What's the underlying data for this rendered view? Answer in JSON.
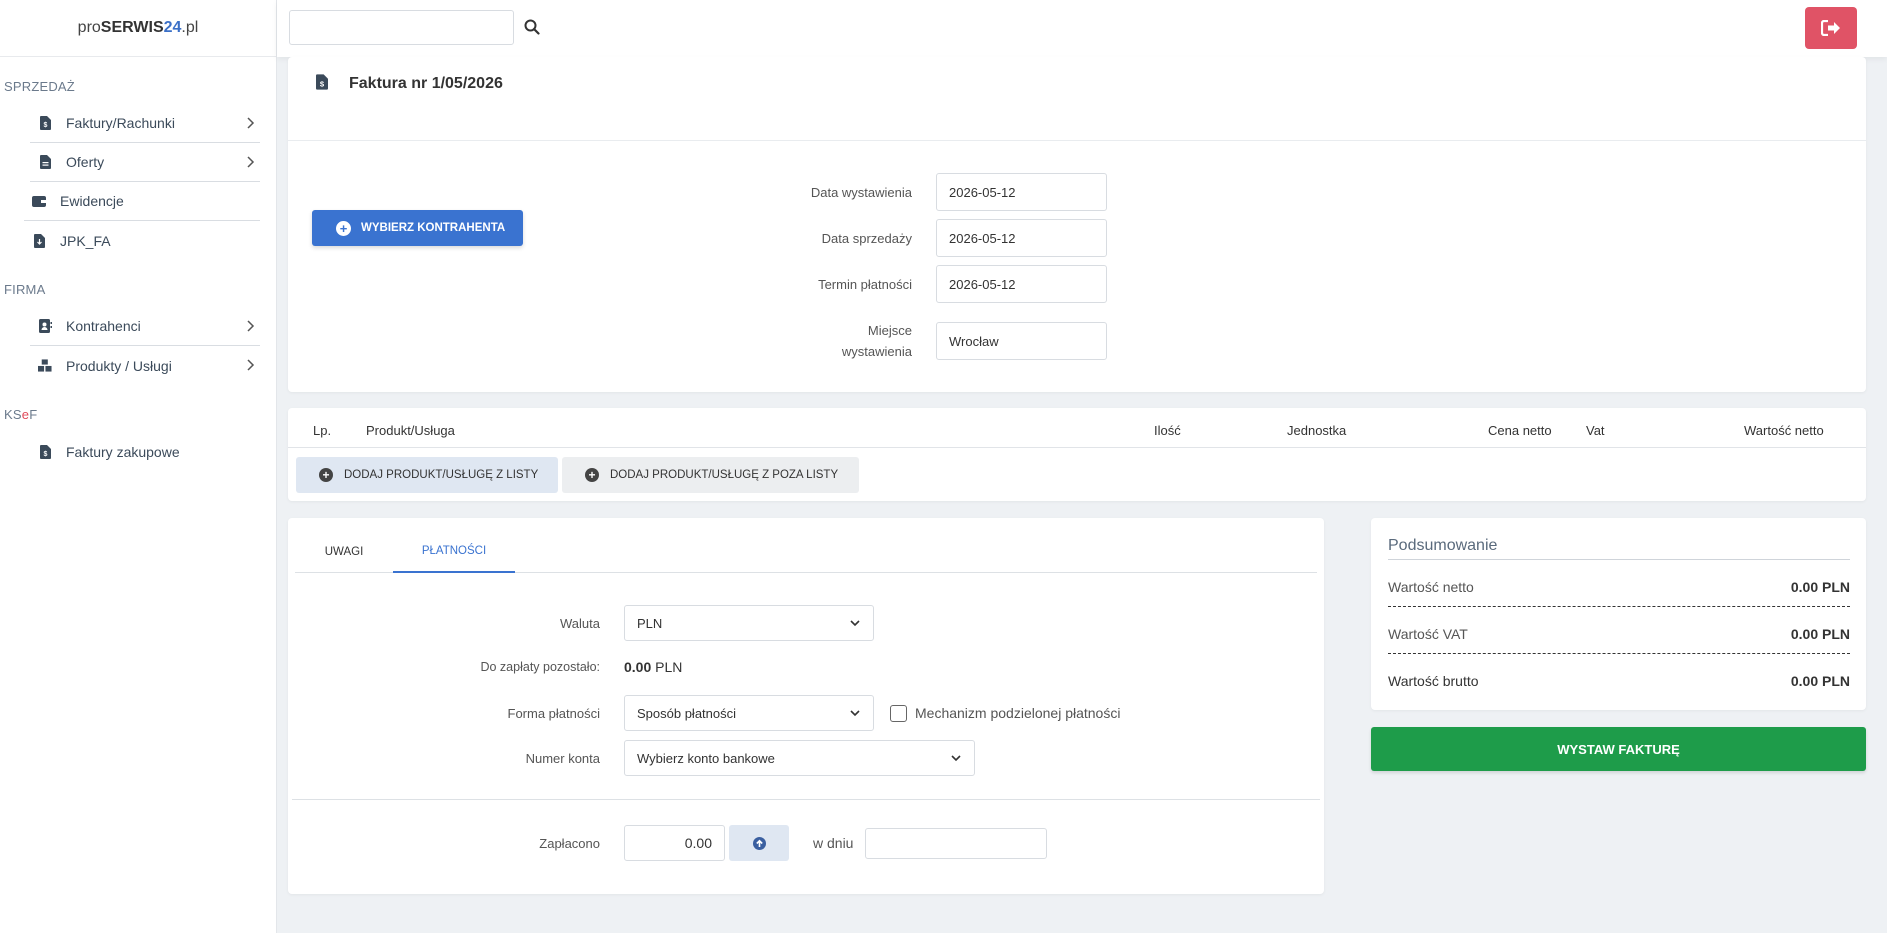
{
  "brand": {
    "pre": "pro",
    "bold": "SERWIS",
    "num": "24",
    "suffix": ".pl"
  },
  "sidebar": {
    "sections": [
      {
        "title": "SPRZEDAŻ",
        "items": [
          {
            "label": "Faktury/Rachunki",
            "icon": "file-invoice-icon",
            "has_chevron": true
          },
          {
            "label": "Oferty",
            "icon": "file-icon",
            "has_chevron": true
          },
          {
            "label": "Ewidencje",
            "icon": "wallet-icon",
            "has_chevron": false
          },
          {
            "label": "JPK_FA",
            "icon": "file-download-icon",
            "has_chevron": false
          }
        ]
      },
      {
        "title": "FIRMA",
        "items": [
          {
            "label": "Kontrahenci",
            "icon": "address-book-icon",
            "has_chevron": true
          },
          {
            "label": "Produkty / Usługi",
            "icon": "boxes-icon",
            "has_chevron": true
          }
        ]
      },
      {
        "title_k": "KS",
        "title_e": "e",
        "title_f": "F",
        "items": [
          {
            "label": "Faktury zakupowe",
            "icon": "file-invoice-icon",
            "has_chevron": false
          }
        ]
      }
    ]
  },
  "topbar": {
    "search_value": ""
  },
  "invoice": {
    "title": "Faktura nr 1/05/2026",
    "pick_contractor_label": "WYBIERZ KONTRAHENTA",
    "fields": {
      "issue_date_label": "Data wystawienia",
      "issue_date": "2026-05-12",
      "sale_date_label": "Data sprzedaży",
      "sale_date": "2026-05-12",
      "due_date_label": "Termin płatności",
      "due_date": "2026-05-12",
      "place_label_1": "Miejsce",
      "place_label_2": "wystawienia",
      "place": "Wrocław"
    }
  },
  "items_table": {
    "columns": {
      "lp": "Lp.",
      "product": "Produkt/Usługa",
      "qty": "Ilość",
      "unit": "Jednostka",
      "net_price": "Cena netto",
      "vat": "Vat",
      "net_value": "Wartość netto"
    },
    "add_from_list": "DODAJ PRODUKT/USŁUGĘ Z LISTY",
    "add_outside_list": "DODAJ PRODUKT/USŁUGĘ Z POZA LISTY"
  },
  "payments": {
    "tabs": {
      "notes": "UWAGI",
      "payments": "PŁATNOŚCI"
    },
    "currency_label": "Waluta",
    "currency": "PLN",
    "remaining_label": "Do zapłaty pozostało:",
    "remaining_amount": "0.00",
    "remaining_currency": "PLN",
    "method_label": "Forma płatności",
    "method_placeholder": "Sposób płatności",
    "split_label": "Mechanizm podzielonej płatności",
    "account_label": "Numer konta",
    "account_placeholder": "Wybierz konto bankowe",
    "paid_label": "Zapłacono",
    "paid_value": "0.00",
    "on_day_label": "w dniu",
    "on_day_value": ""
  },
  "summary": {
    "title": "Podsumowanie",
    "net_label": "Wartość netto",
    "net": "0.00 PLN",
    "vat_label": "Wartość VAT",
    "vat": "0.00 PLN",
    "gross_label": "Wartość brutto",
    "gross": "0.00 PLN",
    "issue_button": "WYSTAW FAKTURĘ"
  },
  "colors": {
    "primary": "#3a73d0",
    "success": "#1e9c4a",
    "danger": "#e05366",
    "ksef_e": "#e04a5a"
  }
}
